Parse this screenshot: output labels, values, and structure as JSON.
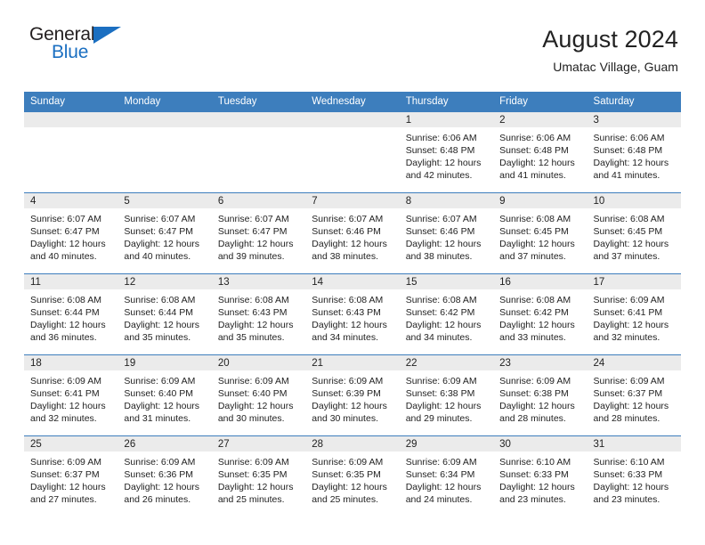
{
  "brand": {
    "name_part1": "General",
    "name_part2": "Blue",
    "triangle_color": "#1b6fc1"
  },
  "header": {
    "title": "August 2024",
    "subtitle": "Umatac Village, Guam"
  },
  "theme": {
    "header_bar_color": "#3d7ebd",
    "date_band_color": "#ebebeb",
    "text_color": "#222222"
  },
  "weekdays": [
    "Sunday",
    "Monday",
    "Tuesday",
    "Wednesday",
    "Thursday",
    "Friday",
    "Saturday"
  ],
  "weeks": [
    [
      {
        "date": "",
        "lines": []
      },
      {
        "date": "",
        "lines": []
      },
      {
        "date": "",
        "lines": []
      },
      {
        "date": "",
        "lines": []
      },
      {
        "date": "1",
        "lines": [
          "Sunrise: 6:06 AM",
          "Sunset: 6:48 PM",
          "Daylight: 12 hours",
          "and 42 minutes."
        ]
      },
      {
        "date": "2",
        "lines": [
          "Sunrise: 6:06 AM",
          "Sunset: 6:48 PM",
          "Daylight: 12 hours",
          "and 41 minutes."
        ]
      },
      {
        "date": "3",
        "lines": [
          "Sunrise: 6:06 AM",
          "Sunset: 6:48 PM",
          "Daylight: 12 hours",
          "and 41 minutes."
        ]
      }
    ],
    [
      {
        "date": "4",
        "lines": [
          "Sunrise: 6:07 AM",
          "Sunset: 6:47 PM",
          "Daylight: 12 hours",
          "and 40 minutes."
        ]
      },
      {
        "date": "5",
        "lines": [
          "Sunrise: 6:07 AM",
          "Sunset: 6:47 PM",
          "Daylight: 12 hours",
          "and 40 minutes."
        ]
      },
      {
        "date": "6",
        "lines": [
          "Sunrise: 6:07 AM",
          "Sunset: 6:47 PM",
          "Daylight: 12 hours",
          "and 39 minutes."
        ]
      },
      {
        "date": "7",
        "lines": [
          "Sunrise: 6:07 AM",
          "Sunset: 6:46 PM",
          "Daylight: 12 hours",
          "and 38 minutes."
        ]
      },
      {
        "date": "8",
        "lines": [
          "Sunrise: 6:07 AM",
          "Sunset: 6:46 PM",
          "Daylight: 12 hours",
          "and 38 minutes."
        ]
      },
      {
        "date": "9",
        "lines": [
          "Sunrise: 6:08 AM",
          "Sunset: 6:45 PM",
          "Daylight: 12 hours",
          "and 37 minutes."
        ]
      },
      {
        "date": "10",
        "lines": [
          "Sunrise: 6:08 AM",
          "Sunset: 6:45 PM",
          "Daylight: 12 hours",
          "and 37 minutes."
        ]
      }
    ],
    [
      {
        "date": "11",
        "lines": [
          "Sunrise: 6:08 AM",
          "Sunset: 6:44 PM",
          "Daylight: 12 hours",
          "and 36 minutes."
        ]
      },
      {
        "date": "12",
        "lines": [
          "Sunrise: 6:08 AM",
          "Sunset: 6:44 PM",
          "Daylight: 12 hours",
          "and 35 minutes."
        ]
      },
      {
        "date": "13",
        "lines": [
          "Sunrise: 6:08 AM",
          "Sunset: 6:43 PM",
          "Daylight: 12 hours",
          "and 35 minutes."
        ]
      },
      {
        "date": "14",
        "lines": [
          "Sunrise: 6:08 AM",
          "Sunset: 6:43 PM",
          "Daylight: 12 hours",
          "and 34 minutes."
        ]
      },
      {
        "date": "15",
        "lines": [
          "Sunrise: 6:08 AM",
          "Sunset: 6:42 PM",
          "Daylight: 12 hours",
          "and 34 minutes."
        ]
      },
      {
        "date": "16",
        "lines": [
          "Sunrise: 6:08 AM",
          "Sunset: 6:42 PM",
          "Daylight: 12 hours",
          "and 33 minutes."
        ]
      },
      {
        "date": "17",
        "lines": [
          "Sunrise: 6:09 AM",
          "Sunset: 6:41 PM",
          "Daylight: 12 hours",
          "and 32 minutes."
        ]
      }
    ],
    [
      {
        "date": "18",
        "lines": [
          "Sunrise: 6:09 AM",
          "Sunset: 6:41 PM",
          "Daylight: 12 hours",
          "and 32 minutes."
        ]
      },
      {
        "date": "19",
        "lines": [
          "Sunrise: 6:09 AM",
          "Sunset: 6:40 PM",
          "Daylight: 12 hours",
          "and 31 minutes."
        ]
      },
      {
        "date": "20",
        "lines": [
          "Sunrise: 6:09 AM",
          "Sunset: 6:40 PM",
          "Daylight: 12 hours",
          "and 30 minutes."
        ]
      },
      {
        "date": "21",
        "lines": [
          "Sunrise: 6:09 AM",
          "Sunset: 6:39 PM",
          "Daylight: 12 hours",
          "and 30 minutes."
        ]
      },
      {
        "date": "22",
        "lines": [
          "Sunrise: 6:09 AM",
          "Sunset: 6:38 PM",
          "Daylight: 12 hours",
          "and 29 minutes."
        ]
      },
      {
        "date": "23",
        "lines": [
          "Sunrise: 6:09 AM",
          "Sunset: 6:38 PM",
          "Daylight: 12 hours",
          "and 28 minutes."
        ]
      },
      {
        "date": "24",
        "lines": [
          "Sunrise: 6:09 AM",
          "Sunset: 6:37 PM",
          "Daylight: 12 hours",
          "and 28 minutes."
        ]
      }
    ],
    [
      {
        "date": "25",
        "lines": [
          "Sunrise: 6:09 AM",
          "Sunset: 6:37 PM",
          "Daylight: 12 hours",
          "and 27 minutes."
        ]
      },
      {
        "date": "26",
        "lines": [
          "Sunrise: 6:09 AM",
          "Sunset: 6:36 PM",
          "Daylight: 12 hours",
          "and 26 minutes."
        ]
      },
      {
        "date": "27",
        "lines": [
          "Sunrise: 6:09 AM",
          "Sunset: 6:35 PM",
          "Daylight: 12 hours",
          "and 25 minutes."
        ]
      },
      {
        "date": "28",
        "lines": [
          "Sunrise: 6:09 AM",
          "Sunset: 6:35 PM",
          "Daylight: 12 hours",
          "and 25 minutes."
        ]
      },
      {
        "date": "29",
        "lines": [
          "Sunrise: 6:09 AM",
          "Sunset: 6:34 PM",
          "Daylight: 12 hours",
          "and 24 minutes."
        ]
      },
      {
        "date": "30",
        "lines": [
          "Sunrise: 6:10 AM",
          "Sunset: 6:33 PM",
          "Daylight: 12 hours",
          "and 23 minutes."
        ]
      },
      {
        "date": "31",
        "lines": [
          "Sunrise: 6:10 AM",
          "Sunset: 6:33 PM",
          "Daylight: 12 hours",
          "and 23 minutes."
        ]
      }
    ]
  ]
}
